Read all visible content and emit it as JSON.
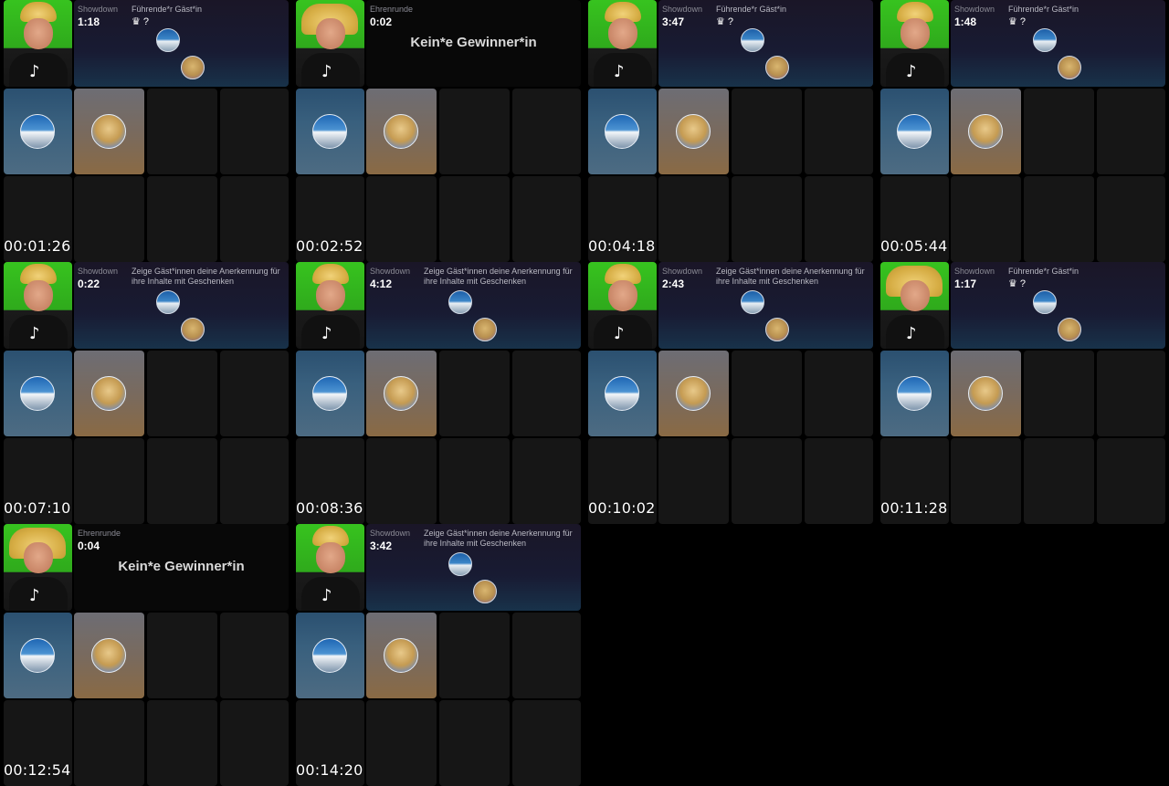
{
  "frames": [
    {
      "timestamp": "00:01:26",
      "label": "Showdown",
      "time": "1:18",
      "info": "Führende*r Gäst*in",
      "crown": "♛ ?",
      "winner": "",
      "hat": "normal"
    },
    {
      "timestamp": "00:02:52",
      "label": "Ehrenrunde",
      "time": "0:02",
      "info": "",
      "crown": "",
      "winner": "Kein*e Gewinner*in",
      "hat": "big"
    },
    {
      "timestamp": "00:04:18",
      "label": "Showdown",
      "time": "3:47",
      "info": "Führende*r Gäst*in",
      "crown": "♛ ?",
      "winner": "",
      "hat": "normal"
    },
    {
      "timestamp": "00:05:44",
      "label": "Showdown",
      "time": "1:48",
      "info": "Führende*r Gäst*in",
      "crown": "♛ ?",
      "winner": "",
      "hat": "normal"
    },
    {
      "timestamp": "00:07:10",
      "label": "Showdown",
      "time": "0:22",
      "info": "Zeige Gäst*innen deine Anerkennung für ihre Inhalte mit Geschenken",
      "crown": "",
      "winner": "",
      "hat": "normal"
    },
    {
      "timestamp": "00:08:36",
      "label": "Showdown",
      "time": "4:12",
      "info": "Zeige Gäst*innen deine Anerkennung für ihre Inhalte mit Geschenken",
      "crown": "",
      "winner": "",
      "hat": "normal"
    },
    {
      "timestamp": "00:10:02",
      "label": "Showdown",
      "time": "2:43",
      "info": "Zeige Gäst*innen deine Anerkennung für ihre Inhalte mit Geschenken",
      "crown": "",
      "winner": "",
      "hat": "normal"
    },
    {
      "timestamp": "00:11:28",
      "label": "Showdown",
      "time": "1:17",
      "info": "Führende*r Gäst*in",
      "crown": "♛ ?",
      "winner": "",
      "hat": "big"
    },
    {
      "timestamp": "00:12:54",
      "label": "Ehrenrunde",
      "time": "0:04",
      "info": "",
      "crown": "",
      "winner": "Kein*e Gewinner*in",
      "hat": "big"
    },
    {
      "timestamp": "00:14:20",
      "label": "Showdown",
      "time": "3:42",
      "info": "Zeige Gäst*innen deine Anerkennung für ihre Inhalte mit Geschenken",
      "crown": "",
      "winner": "",
      "hat": "normal"
    }
  ],
  "icons": {
    "host": "tiktok-icon",
    "crown": "crown-icon"
  },
  "colors": {
    "greenscreen": "#37c31f",
    "banner": "#181b33",
    "tile_empty": "#161616"
  }
}
